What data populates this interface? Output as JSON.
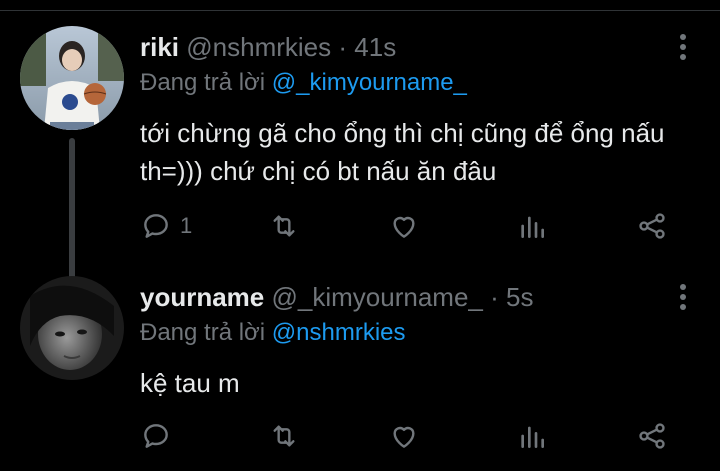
{
  "tweets": [
    {
      "display_name": "riki",
      "handle": "@nshmrkies",
      "separator": "·",
      "time": "41s",
      "replying_prefix": "Đang trả lời",
      "replying_to": "@_kimyourname_",
      "text": "tới chừng gã cho ổng thì chị cũng để ổng nấu th=))) chứ chị có bt nấu ăn đâu",
      "reply_count": "1",
      "avatar": "avatar-photo-boy-with-basketball"
    },
    {
      "display_name": "yourname",
      "handle": "@_kimyourname_",
      "separator": "·",
      "time": "5s",
      "replying_prefix": "Đang trả lời",
      "replying_to": "@nshmrkies",
      "text": "kệ tau m",
      "reply_count": "",
      "avatar": "avatar-photo-girl"
    }
  ],
  "icons": {
    "reply": "reply-icon",
    "retweet": "retweet-icon",
    "like": "heart-icon",
    "views": "views-icon",
    "share": "share-icon",
    "more": "more-vertical-icon"
  },
  "colors": {
    "background": "#000000",
    "primary_text": "#e7e9ea",
    "secondary_text": "#71767b",
    "accent": "#1d9bf0",
    "thread_line": "#3a3d40"
  }
}
